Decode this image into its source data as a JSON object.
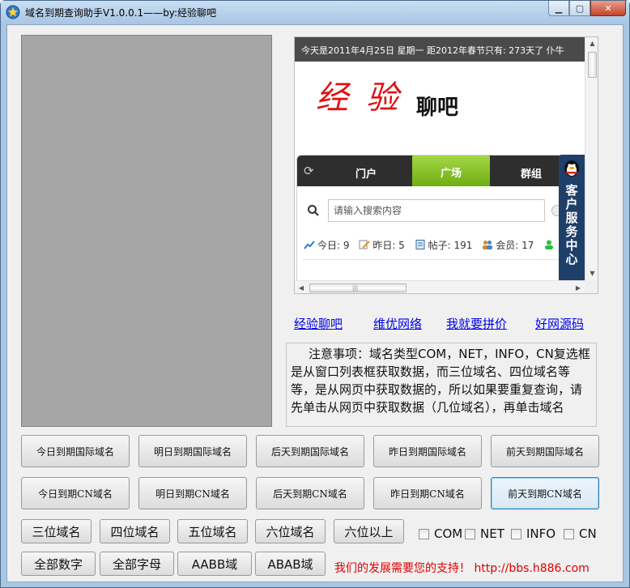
{
  "window": {
    "title": "域名到期查询助手V1.0.0.1——by:经验聊吧",
    "minimize_icon": "minimize-icon",
    "maximize_icon": "maximize-icon",
    "close_icon": "close-icon"
  },
  "browser": {
    "marquee": "今天是2011年4月25日 星期一    距2012年春节只有: 273天了 仆牛",
    "logo": {
      "char1": "经",
      "char2": "验",
      "suffix": "聊吧"
    },
    "nav_tabs": [
      "门户",
      "广场",
      "群组"
    ],
    "active_tab": "广场",
    "search_placeholder": "请输入搜索内容",
    "stats": [
      {
        "icon": "chart-icon",
        "label": "今日: 9"
      },
      {
        "icon": "pencil-icon",
        "label": "昨日: 5"
      },
      {
        "icon": "document-icon",
        "label": "帖子: 191"
      },
      {
        "icon": "users-icon",
        "label": "会员: 17"
      }
    ],
    "qq_service": "客户服务中心"
  },
  "links": [
    "经验聊吧",
    "维优网络",
    "我就要拼价",
    "好网源码"
  ],
  "notice": "注意事项：域名类型COM，NET，INFO，CN复选框是从窗口列表框获取数据，而三位域名、四位域名等等，是从网页中获取数据的，所以如果要重复查询，请先单击从网页中获取数据（几位域名），再单击域名",
  "buttons_row1": [
    "今日到期国际域名",
    "明日到期国际域名",
    "后天到期国际域名",
    "昨日到期国际域名",
    "前天到期国际域名"
  ],
  "buttons_row2": [
    "今日到期CN域名",
    "明日到期CN域名",
    "后天到期CN域名",
    "昨日到期CN域名",
    "前天到期CN域名"
  ],
  "buttons_row3": [
    "三位域名",
    "四位域名",
    "五位域名",
    "六位域名",
    "六位以上"
  ],
  "buttons_row4": [
    "全部数字",
    "全部字母",
    "AABB域",
    "ABAB域"
  ],
  "checkboxes": [
    "COM",
    "NET",
    "INFO",
    "CN"
  ],
  "promo": "我们的发展需要您的支持！ http://bbs.h886.com",
  "colors": {
    "accent_green": "#6fae12",
    "link": "#0000ee",
    "promo_red": "#e00000",
    "logo_red": "#e01010"
  }
}
